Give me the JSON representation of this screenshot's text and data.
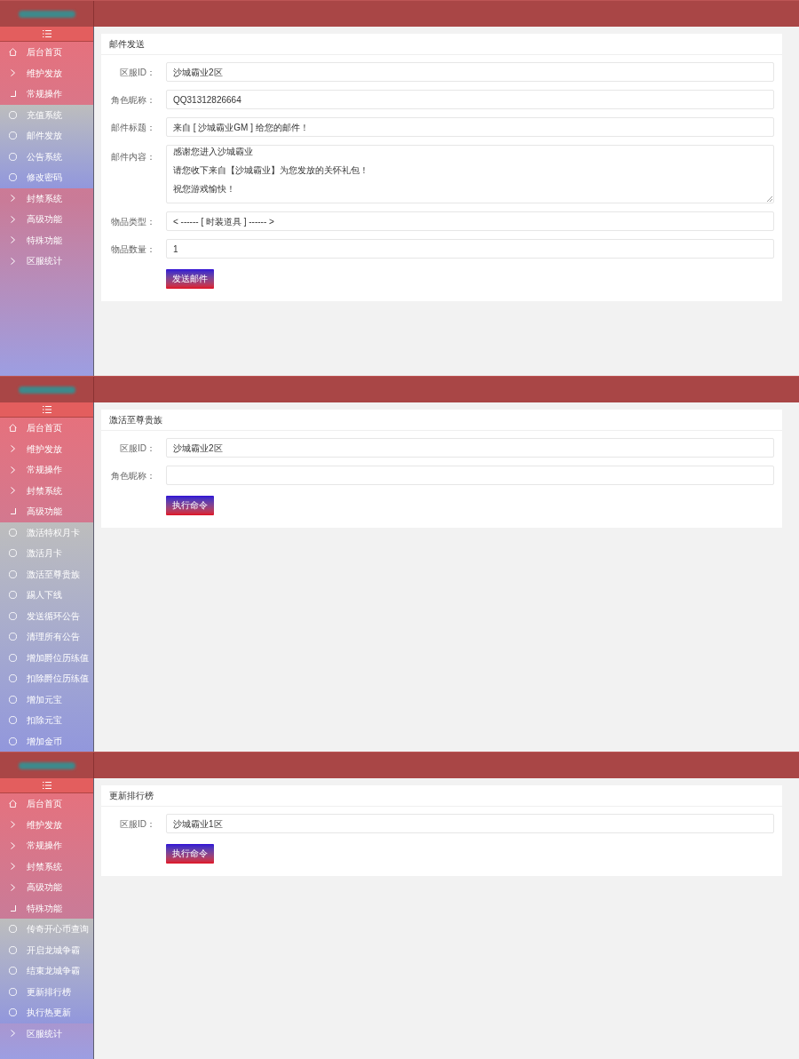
{
  "screens": [
    {
      "sidebar": {
        "items": [
          {
            "label": "后台首页",
            "kind": "home"
          },
          {
            "label": "维护发放",
            "kind": "group",
            "expanded": false
          },
          {
            "label": "常规操作",
            "kind": "group",
            "expanded": true,
            "children": [
              {
                "label": "充值系统"
              },
              {
                "label": "邮件发放"
              },
              {
                "label": "公告系统"
              },
              {
                "label": "修改密码"
              }
            ]
          },
          {
            "label": "封禁系统",
            "kind": "group",
            "expanded": false
          },
          {
            "label": "高级功能",
            "kind": "group",
            "expanded": false
          },
          {
            "label": "特殊功能",
            "kind": "group",
            "expanded": false
          },
          {
            "label": "区服统计",
            "kind": "group",
            "expanded": false
          }
        ]
      },
      "form": {
        "title": "邮件发送",
        "fields": [
          {
            "label": "区服ID：",
            "kind": "input",
            "value": "沙城霸业2区"
          },
          {
            "label": "角色昵称：",
            "kind": "input",
            "value": "QQ31312826664"
          },
          {
            "label": "邮件标题：",
            "kind": "input",
            "value": "来自 [ 沙城霸业GM ] 给您的邮件！"
          },
          {
            "label": "邮件内容：",
            "kind": "textarea",
            "lines": [
              "感谢您进入沙城霸业",
              "请您收下来自【沙城霸业】为您发放的关怀礼包！",
              "祝您游戏愉快！"
            ]
          },
          {
            "label": "物品类型：",
            "kind": "select",
            "value": "< ------ [ 时装道具 ] ------ >"
          },
          {
            "label": "物品数量：",
            "kind": "input",
            "value": "1"
          }
        ],
        "button": "发送邮件"
      }
    },
    {
      "sidebar": {
        "items": [
          {
            "label": "后台首页",
            "kind": "home"
          },
          {
            "label": "维护发放",
            "kind": "group",
            "expanded": false
          },
          {
            "label": "常规操作",
            "kind": "group",
            "expanded": false
          },
          {
            "label": "封禁系统",
            "kind": "group",
            "expanded": false
          },
          {
            "label": "高级功能",
            "kind": "group",
            "expanded": true,
            "children": [
              {
                "label": "激活特权月卡"
              },
              {
                "label": "激活月卡"
              },
              {
                "label": "激活至尊贵族"
              },
              {
                "label": "踢人下线"
              },
              {
                "label": "发送循环公告"
              },
              {
                "label": "清理所有公告"
              },
              {
                "label": "增加爵位历练值"
              },
              {
                "label": "扣除爵位历练值"
              },
              {
                "label": "增加元宝"
              },
              {
                "label": "扣除元宝"
              },
              {
                "label": "增加金币"
              }
            ]
          }
        ]
      },
      "form": {
        "title": "激活至尊贵族",
        "fields": [
          {
            "label": "区服ID：",
            "kind": "input",
            "value": "沙城霸业2区"
          },
          {
            "label": "角色昵称：",
            "kind": "input"
          }
        ],
        "button": "执行命令"
      }
    },
    {
      "sidebar": {
        "items": [
          {
            "label": "后台首页",
            "kind": "home"
          },
          {
            "label": "维护发放",
            "kind": "group",
            "expanded": false
          },
          {
            "label": "常规操作",
            "kind": "group",
            "expanded": false
          },
          {
            "label": "封禁系统",
            "kind": "group",
            "expanded": false
          },
          {
            "label": "高级功能",
            "kind": "group",
            "expanded": false
          },
          {
            "label": "特殊功能",
            "kind": "group",
            "expanded": true,
            "children": [
              {
                "label": "传奇开心币查询"
              },
              {
                "label": "开启龙城争霸"
              },
              {
                "label": "结束龙城争霸"
              },
              {
                "label": "更新排行榜"
              },
              {
                "label": "执行热更新"
              }
            ]
          },
          {
            "label": "区服统计",
            "kind": "group",
            "expanded": false
          }
        ]
      },
      "form": {
        "title": "更新排行榜",
        "fields": [
          {
            "label": "区服ID：",
            "kind": "input",
            "value": "沙城霸业1区"
          }
        ],
        "button": "执行命令"
      }
    }
  ]
}
